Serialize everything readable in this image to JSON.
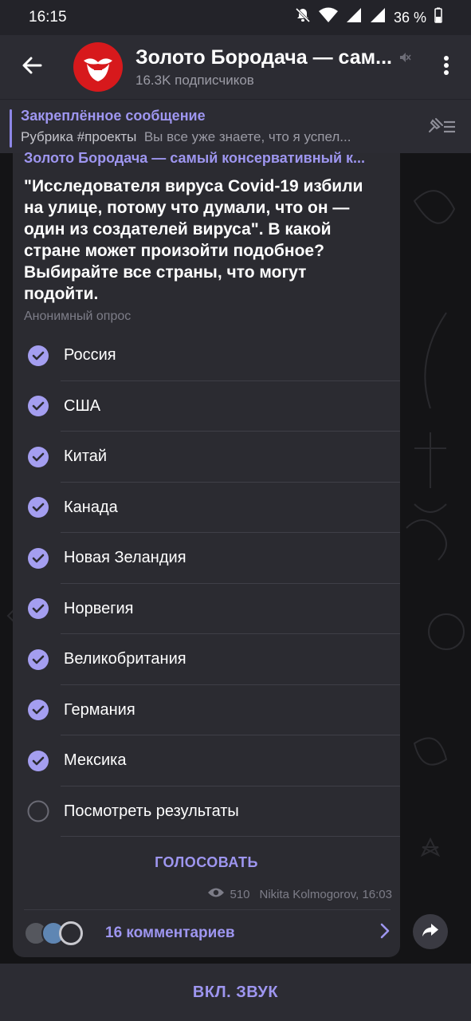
{
  "status_bar": {
    "time": "16:15",
    "battery": "36 %"
  },
  "header": {
    "channel_title": "Золото Бородача — сам...",
    "subscribers": "16.3K подписчиков"
  },
  "pinned": {
    "title": "Закреплённое сообщение",
    "tag": "Рубрика #проекты",
    "text": "Вы все уже знаете, что я успел..."
  },
  "message": {
    "author": "Золото Бородача — самый консервативный к...",
    "question": "\"Исследователя вируса Covid-19 избили на улице, потому что думали, что он — один из создателей вируса\". В какой стране может произойти подобное? Выбирайте все страны, что могут подойти.",
    "poll_type": "Анонимный опрос",
    "options": [
      {
        "label": "Россия",
        "checked": true
      },
      {
        "label": "США",
        "checked": true
      },
      {
        "label": "Китай",
        "checked": true
      },
      {
        "label": "Канада",
        "checked": true
      },
      {
        "label": "Новая Зеландия",
        "checked": true
      },
      {
        "label": "Норвегия",
        "checked": true
      },
      {
        "label": "Великобритания",
        "checked": true
      },
      {
        "label": "Германия",
        "checked": true
      },
      {
        "label": "Мексика",
        "checked": true
      },
      {
        "label": "Посмотреть результаты",
        "checked": false
      }
    ],
    "vote_label": "ГОЛОСОВАТЬ",
    "views": "510",
    "signature": "Nikita Kolmogorov, 16:03",
    "comments_label": "16 комментариев"
  },
  "bottom_bar": {
    "label": "ВКЛ. ЗВУК"
  },
  "colors": {
    "accent": "#9e96f0",
    "check": "#a49ef0",
    "bubble": "#2b2b31",
    "avatar_bg": "#d7191c"
  }
}
